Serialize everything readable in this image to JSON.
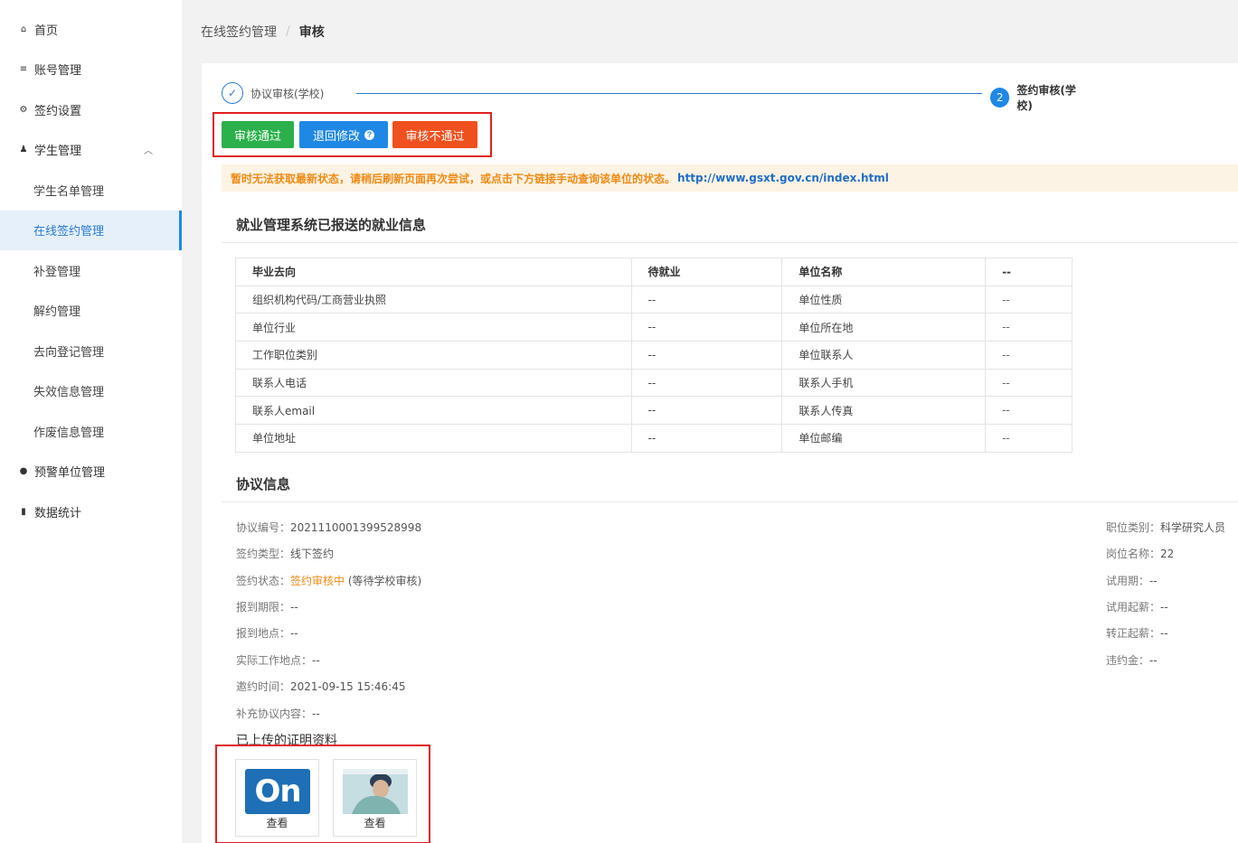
{
  "sidebar": {
    "items": [
      {
        "icon": "home-icon",
        "glyph": "⌂",
        "label": "首页"
      },
      {
        "icon": "list-icon",
        "glyph": "≡",
        "label": "账号管理"
      },
      {
        "icon": "gear-icon",
        "glyph": "⚙",
        "label": "签约设置"
      },
      {
        "icon": "users-icon",
        "glyph": "♟",
        "label": "学生管理"
      },
      {
        "label": "学生名单管理"
      },
      {
        "label": "在线签约管理"
      },
      {
        "label": "补登管理"
      },
      {
        "label": "解约管理"
      },
      {
        "label": "去向登记管理"
      },
      {
        "label": "失效信息管理"
      },
      {
        "label": "作废信息管理"
      },
      {
        "icon": "alert-icon",
        "glyph": "●",
        "label": "预警单位管理"
      },
      {
        "icon": "chart-icon",
        "glyph": "▮",
        "label": "数据统计"
      }
    ]
  },
  "breadcrumb": {
    "parent": "在线签约管理",
    "sep": "/",
    "current": "审核"
  },
  "steps": {
    "step1": "协议审核(学校)",
    "step2_num": "2",
    "step2": "签约审核(学校)"
  },
  "actions": {
    "pass": "审核通过",
    "return": "退回修改",
    "reject": "审核不通过"
  },
  "warning": {
    "text": "暂时无法获取最新状态，请稍后刷新页面再次尝试，或点击下方链接手动查询该单位的状态。",
    "link": "http://www.gsxt.gov.cn/index.html"
  },
  "employment": {
    "title": "就业管理系统已报送的就业信息",
    "rows": [
      [
        "毕业去向",
        "待就业",
        "单位名称",
        "--"
      ],
      [
        "组织机构代码/工商营业执照",
        "--",
        "单位性质",
        "--"
      ],
      [
        "单位行业",
        "--",
        "单位所在地",
        "--"
      ],
      [
        "工作职位类别",
        "--",
        "单位联系人",
        "--"
      ],
      [
        "联系人电话",
        "--",
        "联系人手机",
        "--"
      ],
      [
        "联系人email",
        "--",
        "联系人传真",
        "--"
      ],
      [
        "单位地址",
        "--",
        "单位邮编",
        "--"
      ]
    ]
  },
  "agreement": {
    "title": "协议信息",
    "no_label": "协议编号：",
    "no": "2021110001399528998",
    "type_label": "签约类型：",
    "type": "线下签约",
    "status_label": "签约状态：",
    "status": "签约审核中",
    "status_note": "(等待学校审核)",
    "period_label": "报到期限：",
    "period": "--",
    "place_label": "报到地点：",
    "place": "--",
    "work_label": "实际工作地点：",
    "work": "--",
    "time_label": "邀约时间：",
    "time": "2021-09-15 15:46:45",
    "extra_label": "补充协议内容：",
    "extra": "--",
    "job_label": "职位类别：",
    "job": "科学研究人员",
    "post_label": "岗位名称：",
    "post": "22",
    "trial_label": "试用期：",
    "trial": "--",
    "trial_pay_label": "试用起薪：",
    "trial_pay": "--",
    "regular_pay_label": "转正起薪：",
    "regular_pay": "--",
    "penalty_label": "违约金：",
    "penalty": "--"
  },
  "uploads": {
    "title": "已上传的证明资料",
    "logo_text": "On",
    "view": "查看"
  },
  "colors": {
    "primary": "#1f88e5",
    "pass": "#2bb04b",
    "reject": "#f0501e",
    "warning": "#f08a14",
    "highlight": "#e02020"
  }
}
